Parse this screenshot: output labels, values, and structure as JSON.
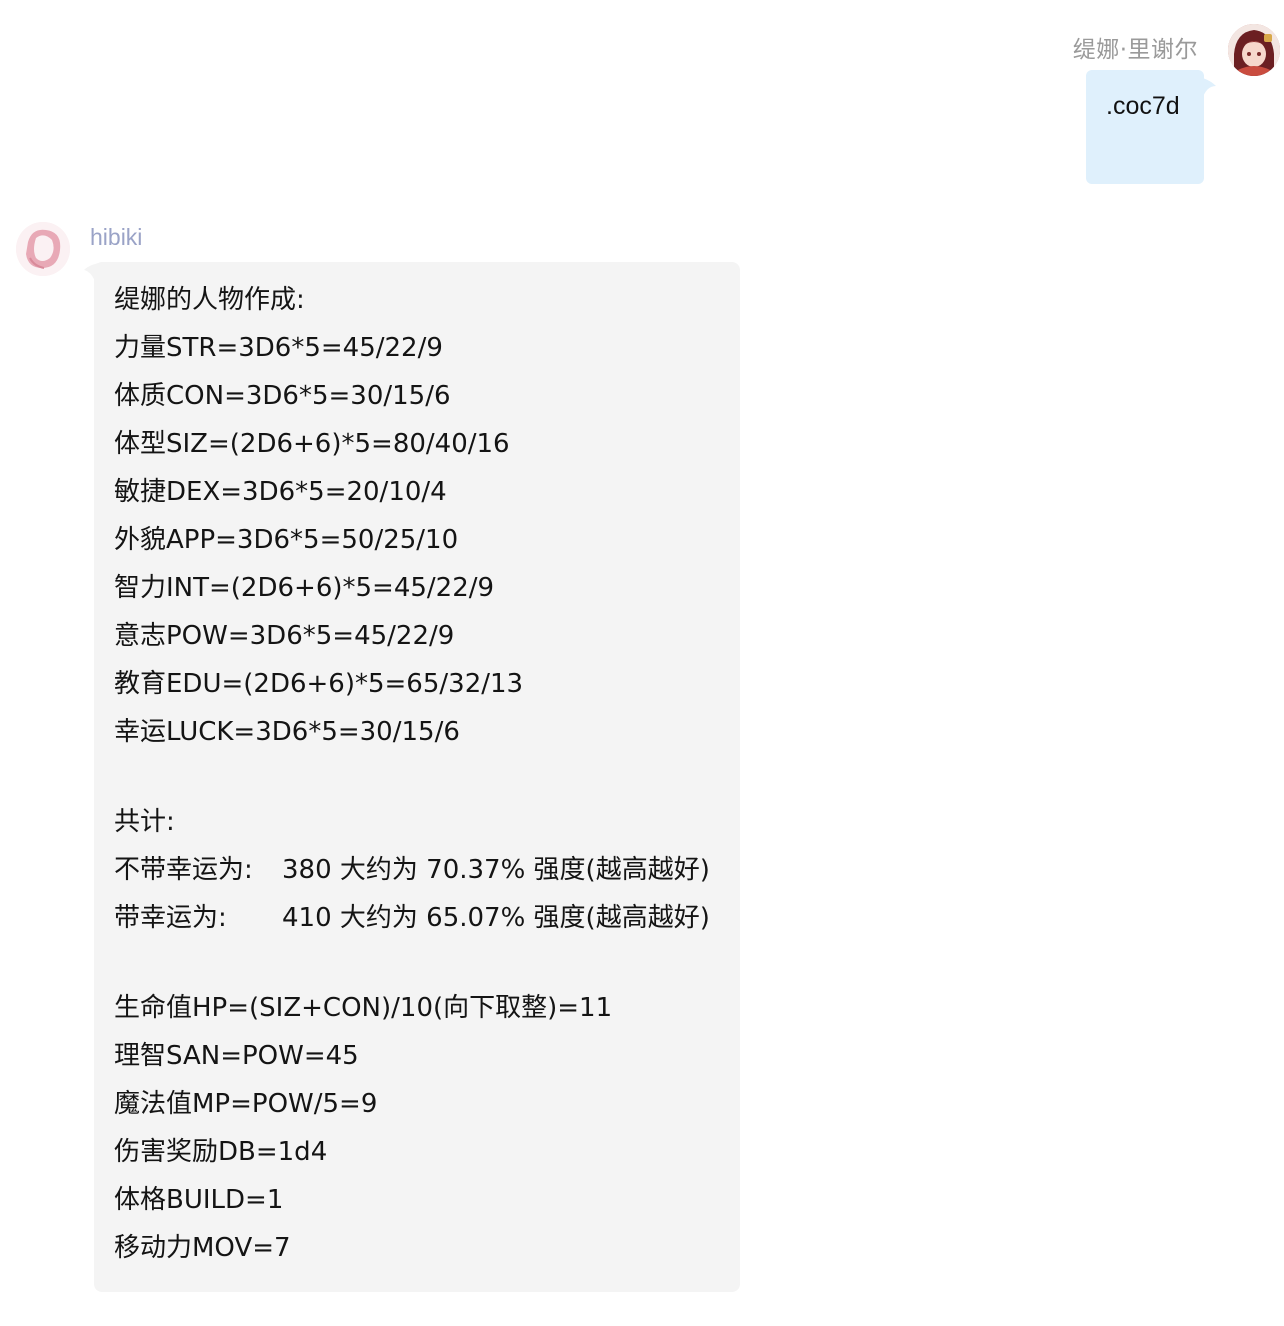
{
  "outgoing": {
    "sender_name": "缇娜·里谢尔",
    "message": ".coc7d",
    "bubble_color": "#dff0fc"
  },
  "incoming": {
    "sender_name": "hibiki",
    "bubble_color": "#f4f4f4",
    "lines": {
      "title": "缇娜的人物作成:",
      "str": "力量STR=3D6*5=45/22/9",
      "con": "体质CON=3D6*5=30/15/6",
      "siz": "体型SIZ=(2D6+6)*5=80/40/16",
      "dex": "敏捷DEX=3D6*5=20/10/4",
      "app": "外貌APP=3D6*5=50/25/10",
      "int": "智力INT=(2D6+6)*5=45/22/9",
      "pow": "意志POW=3D6*5=45/22/9",
      "edu": "教育EDU=(2D6+6)*5=65/32/13",
      "luck": "幸运LUCK=3D6*5=30/15/6",
      "total_label": "共计:",
      "no_luck_label": "不带幸运为:",
      "no_luck_value": "380 大约为 70.37% 强度(越高越好)",
      "with_luck_label": "带幸运为:",
      "with_luck_value": "410 大约为 65.07% 强度(越高越好)",
      "hp": "生命值HP=(SIZ+CON)/10(向下取整)=11",
      "san": "理智SAN=POW=45",
      "mp": "魔法值MP=POW/5=9",
      "db": "伤害奖励DB=1d4",
      "build": "体格BUILD=1",
      "mov": "移动力MOV=7"
    }
  }
}
